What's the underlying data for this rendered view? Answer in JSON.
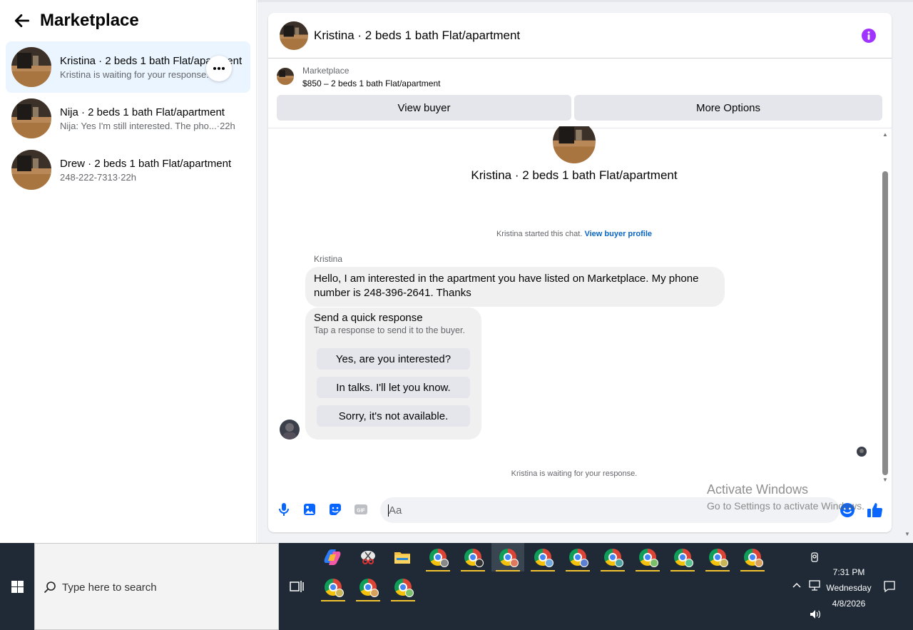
{
  "sidebar": {
    "title": "Marketplace",
    "conversations": [
      {
        "title": "Kristina · 2 beds 1 bath Flat/apartment",
        "subtitle": "Kristina is waiting for your response.",
        "time": ""
      },
      {
        "title": "Nija · 2 beds 1 bath Flat/apartment",
        "subtitle": "Nija: Yes I'm still interested. The pho...",
        "time": " ·22h"
      },
      {
        "title": "Drew · 2 beds 1 bath Flat/apartment",
        "subtitle": "248-222-7313",
        "time": " ·22h"
      }
    ]
  },
  "chat": {
    "title": "Kristina · 2 beds 1 bath Flat/apartment",
    "listing": {
      "source": "Marketplace",
      "price_title": "$850 – 2 beds 1 bath Flat/apartment",
      "view_buyer": "View buyer",
      "more_options": "More Options"
    },
    "intro_title": "Kristina · 2 beds 1 bath Flat/apartment",
    "started_text": "Kristina started this chat.",
    "view_profile": "View buyer profile",
    "sender": "Kristina",
    "message": "Hello, I am interested in the apartment you have listed on Marketplace. My phone number is 248-396-2641. Thanks",
    "quick": {
      "title": "Send a quick response",
      "subtitle": "Tap a response to send it to the buyer.",
      "options": [
        "Yes, are you interested?",
        "In talks. I'll let you know.",
        "Sorry, it's not available."
      ]
    },
    "waiting": "Kristina is waiting for your response.",
    "input_placeholder": "Aa"
  },
  "watermark": {
    "line1": "Activate Windows",
    "line2": "Go to Settings to activate Windows."
  },
  "taskbar": {
    "search_placeholder": "Type here to search",
    "time": "7:31 PM",
    "day": "Wednesday",
    "date": "4/8/2026"
  },
  "colors": {
    "accent": "#0866ff",
    "info": "#a033ff",
    "link": "#0a66c2"
  }
}
